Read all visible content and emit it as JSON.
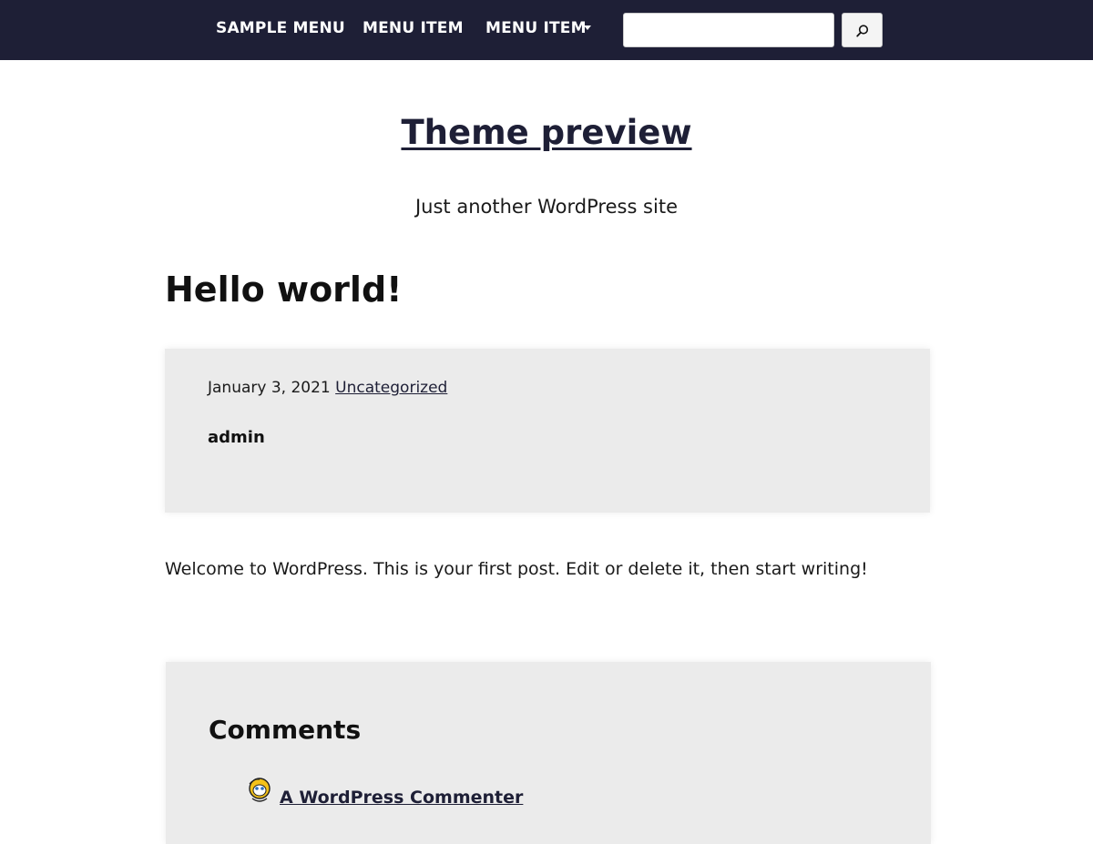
{
  "nav": {
    "items": [
      {
        "label": "SAMPLE MENU"
      },
      {
        "label": "MENU ITEM"
      },
      {
        "label": "MENU ITEM",
        "has_dropdown": true
      }
    ],
    "search": {
      "value": "",
      "placeholder": ""
    },
    "search_icon": "search-icon"
  },
  "colors": {
    "nav_bg": "#1e1f36",
    "box_bg": "#ebebeb",
    "link": "#1e1f36"
  },
  "site": {
    "title": "Theme preview",
    "tagline": "Just another WordPress site"
  },
  "post": {
    "title": "Hello world!",
    "date": "January 3, 2021",
    "category": "Uncategorized",
    "author": "admin",
    "body": "Welcome to WordPress. This is your first post. Edit or delete it, then start writing!"
  },
  "comments": {
    "heading": "Comments",
    "items": [
      {
        "author": "A WordPress Commenter",
        "avatar_icon": "commenter-avatar-icon"
      }
    ]
  }
}
